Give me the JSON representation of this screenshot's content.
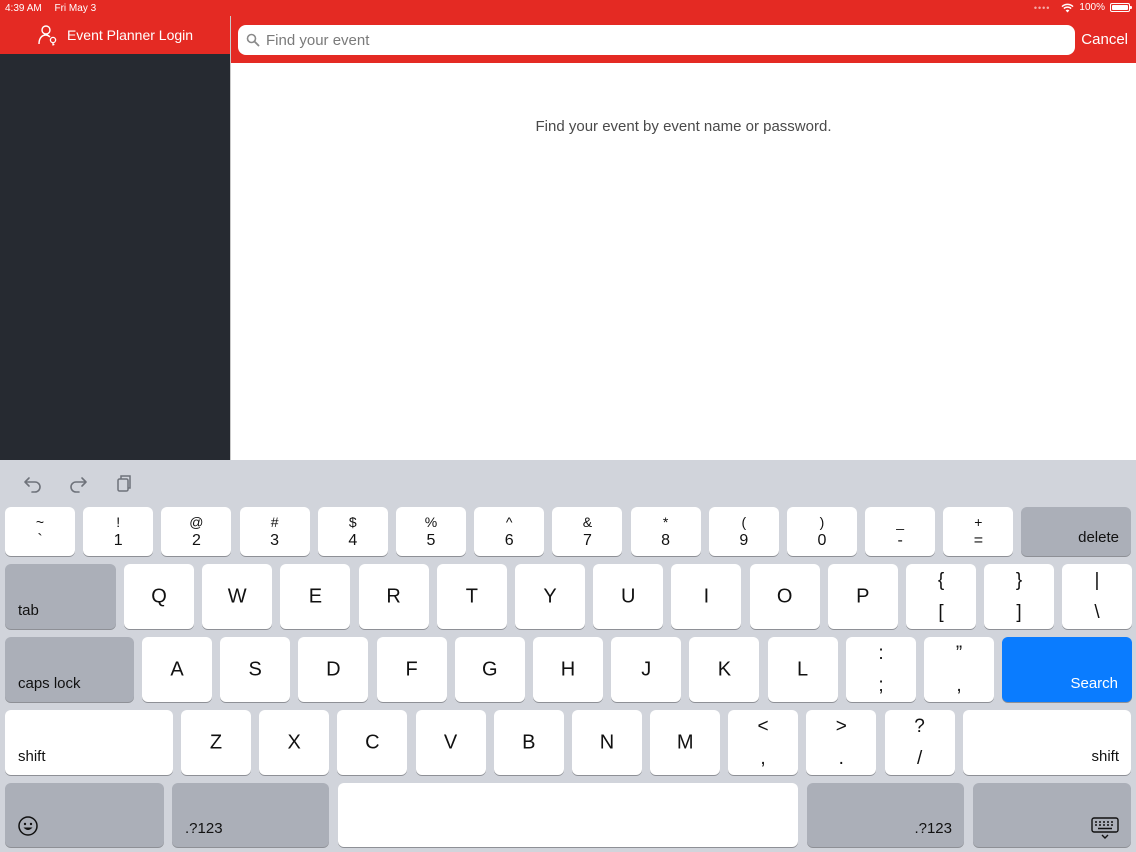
{
  "status": {
    "time": "4:39 AM",
    "date": "Fri May 3",
    "battery": "100%",
    "battery_level": 1.0
  },
  "sidebar": {
    "title": "Event Planner Login"
  },
  "search": {
    "placeholder": "Find your event",
    "cancel": "Cancel"
  },
  "main": {
    "hint": "Find your event by event name or password."
  },
  "keyboard": {
    "row1": [
      {
        "top": "~",
        "bot": "`"
      },
      {
        "top": "!",
        "bot": "1"
      },
      {
        "top": "@",
        "bot": "2"
      },
      {
        "top": "#",
        "bot": "3"
      },
      {
        "top": "$",
        "bot": "4"
      },
      {
        "top": "%",
        "bot": "5"
      },
      {
        "top": "^",
        "bot": "6"
      },
      {
        "top": "&",
        "bot": "7"
      },
      {
        "top": "*",
        "bot": "8"
      },
      {
        "top": "(",
        "bot": "9"
      },
      {
        "top": ")",
        "bot": "0"
      },
      {
        "top": "_",
        "bot": "-"
      },
      {
        "top": "+",
        "bot": "="
      }
    ],
    "row2": [
      "Q",
      "W",
      "E",
      "R",
      "T",
      "Y",
      "U",
      "I",
      "O",
      "P"
    ],
    "row2_sym": [
      {
        "top": "{",
        "bot": "["
      },
      {
        "top": "}",
        "bot": "]"
      },
      {
        "top": "|",
        "bot": "\\"
      }
    ],
    "row3": [
      "A",
      "S",
      "D",
      "F",
      "G",
      "H",
      "J",
      "K",
      "L"
    ],
    "row3_sym": [
      {
        "top": ":",
        "bot": ";"
      },
      {
        "top": "”",
        "bot": ","
      }
    ],
    "row4": [
      "Z",
      "X",
      "C",
      "V",
      "B",
      "N",
      "M"
    ],
    "row4_sym": [
      {
        "top": "<",
        "bot": ","
      },
      {
        "top": ">",
        "bot": "."
      },
      {
        "top": "?",
        "bot": "/"
      }
    ],
    "delete": "delete",
    "tab": "tab",
    "caps_lock": "caps lock",
    "search": "Search",
    "shift": "shift",
    "numbers": ".?123"
  }
}
